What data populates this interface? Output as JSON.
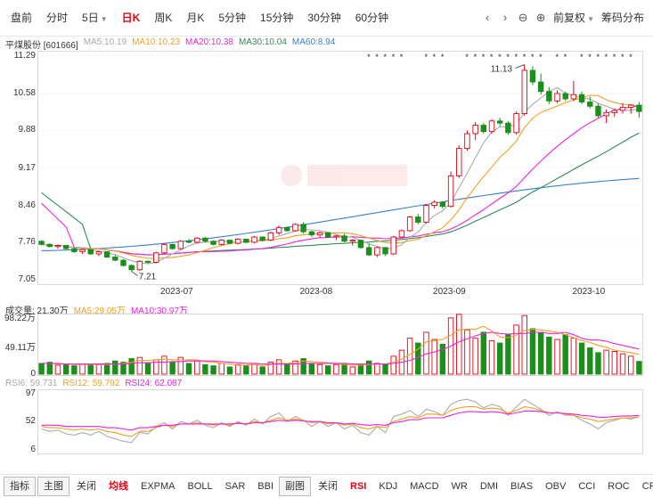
{
  "toolbar": {
    "tabs": [
      {
        "label": "盘前",
        "active": false
      },
      {
        "label": "分时",
        "active": false
      },
      {
        "label": "5日",
        "active": false,
        "dropdown": true
      },
      {
        "label": "日K",
        "active": true
      },
      {
        "label": "周K",
        "active": false
      },
      {
        "label": "月K",
        "active": false
      },
      {
        "label": "5分钟",
        "active": false
      },
      {
        "label": "15分钟",
        "active": false
      },
      {
        "label": "30分钟",
        "active": false
      },
      {
        "label": "60分钟",
        "active": false
      }
    ],
    "prev_icon": "‹",
    "next_icon": "›",
    "zoom_out_icon": "⊖",
    "zoom_in_icon": "⊕",
    "adjust_label": "前复权",
    "chip_label": "筹码分布"
  },
  "price_legend": {
    "stock": "平煤股份 [601666]",
    "ma5": "MA5:10.19",
    "ma10": "MA10:10.23",
    "ma20": "MA20:10.38",
    "ma30": "MA30:10.04",
    "ma60": "MA60:8.94"
  },
  "volume_legend": {
    "label": "成交量: 21.30万",
    "ma5": "MA5:29.05万",
    "ma10": "MA10:30.97万"
  },
  "rsi_legend": {
    "rsi6": "RSI6: 59.731",
    "rsi12": "RSI12: 59.792",
    "rsi24": "RSI24: 62.087"
  },
  "colors": {
    "up": "#e60012",
    "down": "#1a8f1a",
    "ma5": "#aaaaaa",
    "ma10": "#f0a020",
    "ma20": "#ee22dd",
    "ma30": "#2e8b57",
    "ma60": "#3a7fd0"
  },
  "bottom": {
    "left": [
      {
        "label": "指标",
        "boxed": true,
        "active": false
      },
      {
        "label": "主图",
        "boxed": true,
        "active": false
      },
      {
        "label": "关闭",
        "active": false
      },
      {
        "label": "均线",
        "active": true
      },
      {
        "label": "EXPMA",
        "active": false
      },
      {
        "label": "BOLL",
        "active": false
      },
      {
        "label": "SAR",
        "active": false
      },
      {
        "label": "BBI",
        "active": false
      }
    ],
    "right": [
      {
        "label": "副图",
        "boxed": true,
        "active": false
      },
      {
        "label": "关闭",
        "active": false
      },
      {
        "label": "RSI",
        "active": true
      },
      {
        "label": "KDJ",
        "active": false
      },
      {
        "label": "MACD",
        "active": false
      },
      {
        "label": "WR",
        "active": false
      },
      {
        "label": "DMI",
        "active": false
      },
      {
        "label": "BIAS",
        "active": false
      },
      {
        "label": "OBV",
        "active": false
      },
      {
        "label": "CCI",
        "active": false
      },
      {
        "label": "ROC",
        "active": false
      },
      {
        "label": "CR",
        "active": false
      }
    ]
  },
  "chart_data": [
    {
      "type": "candlestick",
      "title": "",
      "y_ticks": [
        "11.29",
        "10.58",
        "9.88",
        "9.17",
        "8.46",
        "7.76",
        "7.05"
      ],
      "ylim": [
        7.05,
        11.29
      ],
      "x_ticks": [
        "2023-07",
        "2023-08",
        "2023-09",
        "2023-10"
      ],
      "annotations": {
        "high": "11.13",
        "low": "7.21"
      },
      "candles": [
        [
          7.78,
          7.8,
          7.7,
          7.72
        ],
        [
          7.72,
          7.74,
          7.66,
          7.68
        ],
        [
          7.68,
          7.72,
          7.64,
          7.7
        ],
        [
          7.7,
          7.71,
          7.62,
          7.64
        ],
        [
          7.64,
          7.66,
          7.56,
          7.58
        ],
        [
          7.58,
          7.64,
          7.54,
          7.62
        ],
        [
          7.62,
          7.63,
          7.52,
          7.54
        ],
        [
          7.54,
          7.6,
          7.5,
          7.58
        ],
        [
          7.58,
          7.59,
          7.46,
          7.48
        ],
        [
          7.48,
          7.52,
          7.4,
          7.42
        ],
        [
          7.42,
          7.44,
          7.3,
          7.32
        ],
        [
          7.32,
          7.34,
          7.21,
          7.24
        ],
        [
          7.24,
          7.42,
          7.22,
          7.4
        ],
        [
          7.4,
          7.41,
          7.36,
          7.38
        ],
        [
          7.38,
          7.58,
          7.36,
          7.56
        ],
        [
          7.56,
          7.74,
          7.54,
          7.72
        ],
        [
          7.72,
          7.73,
          7.62,
          7.64
        ],
        [
          7.64,
          7.8,
          7.62,
          7.78
        ],
        [
          7.78,
          7.82,
          7.74,
          7.76
        ],
        [
          7.76,
          7.86,
          7.74,
          7.84
        ],
        [
          7.84,
          7.86,
          7.76,
          7.78
        ],
        [
          7.78,
          7.8,
          7.7,
          7.72
        ],
        [
          7.72,
          7.82,
          7.7,
          7.8
        ],
        [
          7.8,
          7.81,
          7.72,
          7.74
        ],
        [
          7.74,
          7.84,
          7.72,
          7.82
        ],
        [
          7.82,
          7.83,
          7.74,
          7.76
        ],
        [
          7.76,
          7.88,
          7.74,
          7.86
        ],
        [
          7.86,
          7.87,
          7.78,
          7.8
        ],
        [
          7.8,
          7.96,
          7.78,
          7.94
        ],
        [
          7.94,
          8.08,
          7.9,
          8.04
        ],
        [
          8.04,
          8.06,
          7.96,
          7.98
        ],
        [
          7.98,
          8.12,
          7.96,
          8.1
        ],
        [
          8.1,
          8.14,
          7.92,
          7.96
        ],
        [
          7.96,
          7.98,
          7.86,
          7.9
        ],
        [
          7.9,
          7.96,
          7.84,
          7.94
        ],
        [
          7.94,
          7.95,
          7.84,
          7.86
        ],
        [
          7.86,
          7.9,
          7.8,
          7.88
        ],
        [
          7.88,
          7.92,
          7.76,
          7.78
        ],
        [
          7.78,
          7.82,
          7.7,
          7.8
        ],
        [
          7.8,
          7.81,
          7.64,
          7.66
        ],
        [
          7.66,
          7.74,
          7.5,
          7.52
        ],
        [
          7.52,
          7.68,
          7.48,
          7.66
        ],
        [
          7.66,
          7.67,
          7.5,
          7.54
        ],
        [
          7.54,
          7.88,
          7.52,
          7.86
        ],
        [
          7.86,
          8.0,
          7.84,
          7.98
        ],
        [
          7.98,
          8.26,
          7.96,
          8.24
        ],
        [
          8.24,
          8.3,
          8.1,
          8.14
        ],
        [
          8.14,
          8.48,
          8.12,
          8.46
        ],
        [
          8.46,
          8.56,
          8.4,
          8.52
        ],
        [
          8.52,
          8.54,
          8.4,
          8.44
        ],
        [
          8.44,
          9.1,
          8.42,
          9.02
        ],
        [
          9.02,
          9.6,
          8.98,
          9.54
        ],
        [
          9.54,
          9.88,
          9.5,
          9.82
        ],
        [
          9.82,
          10.04,
          9.7,
          9.98
        ],
        [
          9.98,
          10.02,
          9.82,
          9.86
        ],
        [
          9.86,
          10.1,
          9.82,
          10.06
        ],
        [
          10.06,
          10.12,
          9.96,
          10.02
        ],
        [
          10.02,
          10.06,
          9.8,
          9.84
        ],
        [
          9.84,
          10.24,
          9.8,
          10.2
        ],
        [
          10.2,
          11.13,
          10.16,
          11.02
        ],
        [
          11.02,
          11.1,
          10.74,
          10.8
        ],
        [
          10.8,
          10.96,
          10.56,
          10.62
        ],
        [
          10.62,
          10.7,
          10.38,
          10.44
        ],
        [
          10.44,
          10.64,
          10.4,
          10.58
        ],
        [
          10.58,
          10.62,
          10.44,
          10.48
        ],
        [
          10.48,
          10.82,
          10.44,
          10.56
        ],
        [
          10.56,
          10.62,
          10.38,
          10.42
        ],
        [
          10.42,
          10.52,
          10.3,
          10.34
        ],
        [
          10.34,
          10.4,
          10.12,
          10.16
        ],
        [
          10.16,
          10.28,
          10.02,
          10.22
        ],
        [
          10.22,
          10.3,
          10.14,
          10.26
        ],
        [
          10.26,
          10.4,
          10.2,
          10.32
        ],
        [
          10.32,
          10.38,
          10.2,
          10.36
        ],
        [
          10.36,
          10.42,
          10.12,
          10.24
        ]
      ]
    },
    {
      "type": "bar",
      "title": "",
      "y_ticks": [
        "98.22万",
        "49.11万",
        "0"
      ],
      "ylim": [
        0,
        98.22
      ],
      "values": [
        18,
        20,
        15,
        16,
        14,
        17,
        15,
        16,
        18,
        22,
        20,
        26,
        28,
        18,
        24,
        30,
        20,
        28,
        18,
        22,
        16,
        14,
        18,
        12,
        16,
        14,
        18,
        12,
        20,
        24,
        16,
        22,
        26,
        18,
        16,
        14,
        16,
        18,
        12,
        16,
        22,
        18,
        16,
        30,
        40,
        60,
        52,
        70,
        58,
        50,
        94,
        100,
        74,
        60,
        70,
        56,
        52,
        66,
        82,
        98,
        76,
        70,
        62,
        58,
        66,
        60,
        52,
        44,
        36,
        40,
        38,
        34,
        30,
        21.3
      ],
      "ma5": [
        18,
        18,
        17,
        17,
        16,
        16,
        16,
        16,
        16,
        17,
        18,
        20,
        23,
        23,
        24,
        25,
        24,
        24,
        24,
        24,
        21,
        20,
        18,
        17,
        15,
        15,
        16,
        14,
        16,
        18,
        18,
        19,
        22,
        21,
        20,
        19,
        18,
        16,
        15,
        15,
        16,
        17,
        17,
        20,
        25,
        33,
        42,
        54,
        56,
        58,
        65,
        74,
        75,
        75,
        80,
        72,
        62,
        61,
        65,
        73,
        75,
        74,
        72,
        70,
        66,
        61,
        56,
        53,
        48,
        45,
        40,
        38,
        36,
        33
      ],
      "ma10": [
        18,
        18,
        18,
        17,
        17,
        17,
        17,
        17,
        17,
        17,
        17,
        18,
        19,
        19,
        20,
        20,
        21,
        21,
        22,
        22,
        22,
        22,
        21,
        20,
        19,
        18,
        18,
        17,
        17,
        17,
        17,
        17,
        18,
        18,
        18,
        18,
        18,
        18,
        17,
        17,
        17,
        17,
        17,
        18,
        20,
        23,
        28,
        34,
        37,
        41,
        47,
        54,
        59,
        64,
        68,
        70,
        68,
        67,
        68,
        68,
        70,
        70,
        68,
        68,
        70,
        66,
        60,
        57,
        57,
        55,
        51,
        48,
        45,
        42
      ],
      "colors": [
        "up",
        "down"
      ]
    },
    {
      "type": "line",
      "title": "",
      "y_ticks": [
        "97",
        "52",
        "6"
      ],
      "ylim": [
        6,
        97
      ],
      "series": [
        {
          "name": "RSI6",
          "values": [
            40,
            36,
            38,
            32,
            30,
            34,
            30,
            36,
            28,
            24,
            20,
            18,
            34,
            32,
            44,
            50,
            40,
            52,
            48,
            54,
            46,
            42,
            50,
            44,
            52,
            46,
            56,
            48,
            60,
            66,
            52,
            60,
            54,
            44,
            52,
            44,
            50,
            40,
            46,
            34,
            30,
            44,
            34,
            60,
            64,
            70,
            60,
            72,
            68,
            62,
            80,
            86,
            88,
            84,
            74,
            80,
            76,
            62,
            76,
            88,
            80,
            72,
            62,
            68,
            62,
            62,
            54,
            48,
            40,
            50,
            54,
            58,
            56,
            59.731
          ]
        },
        {
          "name": "RSI12",
          "values": [
            44,
            42,
            42,
            40,
            38,
            40,
            38,
            40,
            36,
            34,
            30,
            28,
            36,
            36,
            42,
            46,
            44,
            48,
            48,
            50,
            48,
            46,
            48,
            46,
            50,
            48,
            52,
            50,
            54,
            58,
            54,
            56,
            54,
            50,
            52,
            48,
            50,
            46,
            48,
            42,
            40,
            44,
            42,
            52,
            56,
            60,
            58,
            64,
            64,
            62,
            70,
            74,
            76,
            76,
            72,
            74,
            72,
            66,
            70,
            76,
            74,
            70,
            66,
            66,
            64,
            62,
            58,
            56,
            52,
            54,
            56,
            58,
            58,
            59.792
          ]
        },
        {
          "name": "RSI24",
          "values": [
            46,
            46,
            46,
            44,
            44,
            44,
            44,
            44,
            42,
            42,
            40,
            38,
            42,
            42,
            44,
            46,
            46,
            48,
            48,
            48,
            48,
            48,
            48,
            48,
            49,
            48,
            50,
            50,
            52,
            54,
            53,
            54,
            53,
            52,
            52,
            50,
            50,
            48,
            49,
            47,
            46,
            47,
            46,
            50,
            52,
            55,
            55,
            58,
            58,
            58,
            62,
            66,
            68,
            68,
            67,
            68,
            67,
            64,
            66,
            69,
            69,
            68,
            66,
            66,
            65,
            64,
            62,
            61,
            59,
            59,
            60,
            61,
            61,
            62.087
          ]
        }
      ]
    }
  ]
}
